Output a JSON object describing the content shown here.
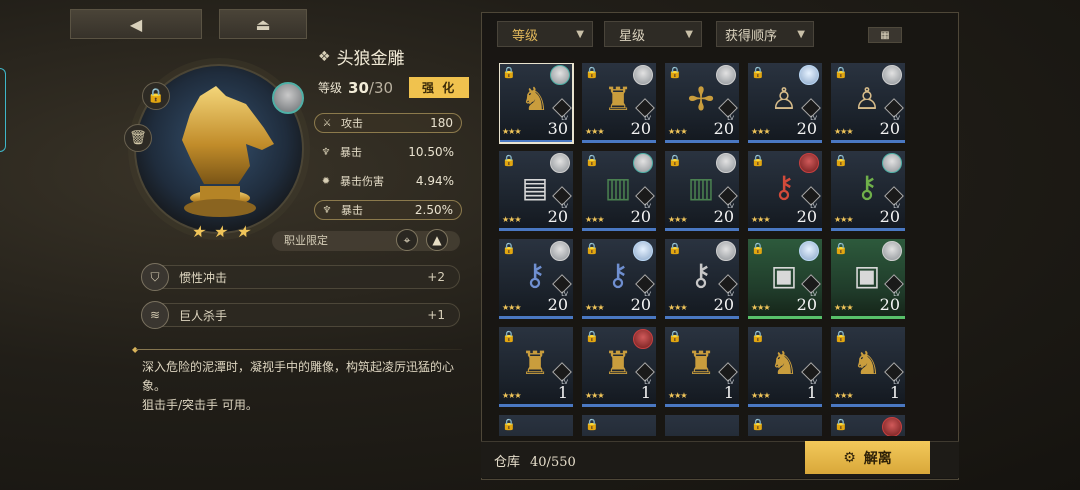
{
  "nav": {
    "back_icon": "back-arrow-icon",
    "home_icon": "home-icon"
  },
  "artifact": {
    "name": "头狼金雕",
    "level_label": "等级",
    "level_current": "30",
    "level_max": "30",
    "enhance_label": "强 化",
    "stars": 3,
    "class_limit_label": "职业限定"
  },
  "stats": [
    {
      "icon": "sword-icon",
      "name": "攻击",
      "value": "180",
      "highlight": true
    },
    {
      "icon": "crit-icon",
      "name": "暴击",
      "value": "10.50%",
      "highlight": false
    },
    {
      "icon": "crit-damage-icon",
      "name": "暴击伤害",
      "value": "4.94%",
      "highlight": false
    },
    {
      "icon": "crit-icon",
      "name": "暴击",
      "value": "2.50%",
      "highlight": true
    }
  ],
  "skills": [
    {
      "icon": "shield-icon",
      "name": "惯性冲击",
      "bonus": "+2"
    },
    {
      "icon": "claw-icon",
      "name": "巨人杀手",
      "bonus": "+1"
    }
  ],
  "description": {
    "text": "深入危险的泥潭时，凝视手中的雕像，构筑起凌厉迅猛的心象。",
    "classes": "狙击手/突击手 可用。"
  },
  "sort": {
    "primary": "等级",
    "secondary": "星级",
    "tertiary": "获得顺序"
  },
  "inventory": {
    "items": [
      {
        "art": "wolf-statue",
        "level": "30",
        "stars": "★★★",
        "avatar": "teal",
        "locked": true,
        "selected": true,
        "green": false
      },
      {
        "art": "lion-statue",
        "level": "20",
        "stars": "★★★",
        "avatar": "grey",
        "locked": true,
        "selected": false,
        "green": false
      },
      {
        "art": "eagle-statue",
        "level": "20",
        "stars": "★★★",
        "avatar": "grey",
        "locked": true,
        "selected": false,
        "green": false
      },
      {
        "art": "doll",
        "level": "20",
        "stars": "★★★",
        "avatar": "blue",
        "locked": true,
        "selected": false,
        "green": false
      },
      {
        "art": "doll",
        "level": "20",
        "stars": "★★★",
        "avatar": "grey",
        "locked": true,
        "selected": false,
        "green": false
      },
      {
        "art": "card",
        "level": "20",
        "stars": "★★★",
        "avatar": "grey",
        "locked": true,
        "selected": false,
        "green": false
      },
      {
        "art": "book",
        "level": "20",
        "stars": "★★★",
        "avatar": "teal",
        "locked": true,
        "selected": false,
        "green": false
      },
      {
        "art": "book",
        "level": "20",
        "stars": "★★★",
        "avatar": "grey",
        "locked": true,
        "selected": false,
        "green": false
      },
      {
        "art": "red-key",
        "level": "20",
        "stars": "★★★",
        "avatar": "red",
        "locked": true,
        "selected": false,
        "green": false
      },
      {
        "art": "green-key",
        "level": "20",
        "stars": "★★★",
        "avatar": "teal",
        "locked": true,
        "selected": false,
        "green": false
      },
      {
        "art": "blue-key",
        "level": "20",
        "stars": "★★★",
        "avatar": "grey",
        "locked": true,
        "selected": false,
        "green": false
      },
      {
        "art": "blue-key",
        "level": "20",
        "stars": "★★★",
        "avatar": "blue",
        "locked": true,
        "selected": false,
        "green": false
      },
      {
        "art": "silver-key",
        "level": "20",
        "stars": "★★★",
        "avatar": "grey",
        "locked": true,
        "selected": false,
        "green": false
      },
      {
        "art": "photo",
        "level": "20",
        "stars": "★★★",
        "avatar": "blue",
        "locked": true,
        "selected": false,
        "green": true
      },
      {
        "art": "photo",
        "level": "20",
        "stars": "★★★",
        "avatar": "grey",
        "locked": true,
        "selected": false,
        "green": true
      },
      {
        "art": "lion-statue",
        "level": "1",
        "stars": "★★★",
        "avatar": "",
        "locked": true,
        "selected": false,
        "green": false
      },
      {
        "art": "lion-statue",
        "level": "1",
        "stars": "★★★",
        "avatar": "red",
        "locked": true,
        "selected": false,
        "green": false
      },
      {
        "art": "lion-statue",
        "level": "1",
        "stars": "★★★",
        "avatar": "",
        "locked": true,
        "selected": false,
        "green": false
      },
      {
        "art": "wolf-statue",
        "level": "1",
        "stars": "★★★",
        "avatar": "",
        "locked": true,
        "selected": false,
        "green": false
      },
      {
        "art": "wolf-statue",
        "level": "1",
        "stars": "★★★",
        "avatar": "",
        "locked": true,
        "selected": false,
        "green": false
      },
      {
        "art": "statue",
        "level": "",
        "stars": "",
        "avatar": "",
        "locked": true,
        "selected": false,
        "green": false
      },
      {
        "art": "statue",
        "level": "",
        "stars": "",
        "avatar": "",
        "locked": true,
        "selected": false,
        "green": false
      },
      {
        "art": "statue",
        "level": "",
        "stars": "",
        "avatar": "",
        "locked": false,
        "selected": false,
        "green": false
      },
      {
        "art": "statue",
        "level": "",
        "stars": "",
        "avatar": "",
        "locked": true,
        "selected": false,
        "green": false
      },
      {
        "art": "statue",
        "level": "",
        "stars": "",
        "avatar": "red",
        "locked": true,
        "selected": false,
        "green": false
      }
    ]
  },
  "storage": {
    "label": "仓库",
    "count": "40/550"
  },
  "dismantle_label": "解离",
  "colors": {
    "accent_gold": "#f0c24e",
    "rarity_blue": "#4a78c2",
    "rarity_green": "#58c06a"
  }
}
